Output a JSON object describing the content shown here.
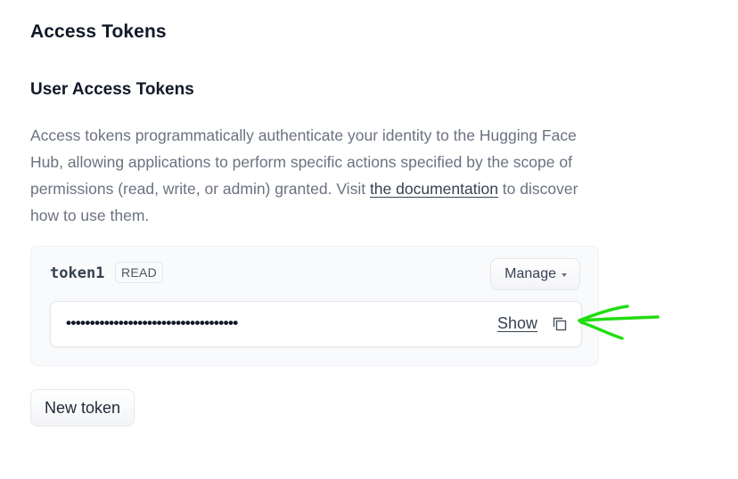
{
  "page": {
    "title": "Access Tokens"
  },
  "section": {
    "title": "User Access Tokens",
    "description_before_link": "Access tokens programmatically authenticate your identity to the Hugging Face Hub, allowing applications to perform specific actions specified by the scope of permissions (read, write, or admin) granted. Visit ",
    "description_link": "the documentation",
    "description_after_link": " to discover how to use them."
  },
  "token": {
    "name": "token1",
    "role": "READ",
    "manage_label": "Manage",
    "masked_value": "••••••••••••••••••••••••••••••••••••",
    "show_label": "Show",
    "copy_icon": "copy-icon"
  },
  "actions": {
    "new_token_label": "New token"
  },
  "colors": {
    "annotation": "#22dd11",
    "text_muted": "#6b7280",
    "card_bg": "#f9fafb"
  }
}
